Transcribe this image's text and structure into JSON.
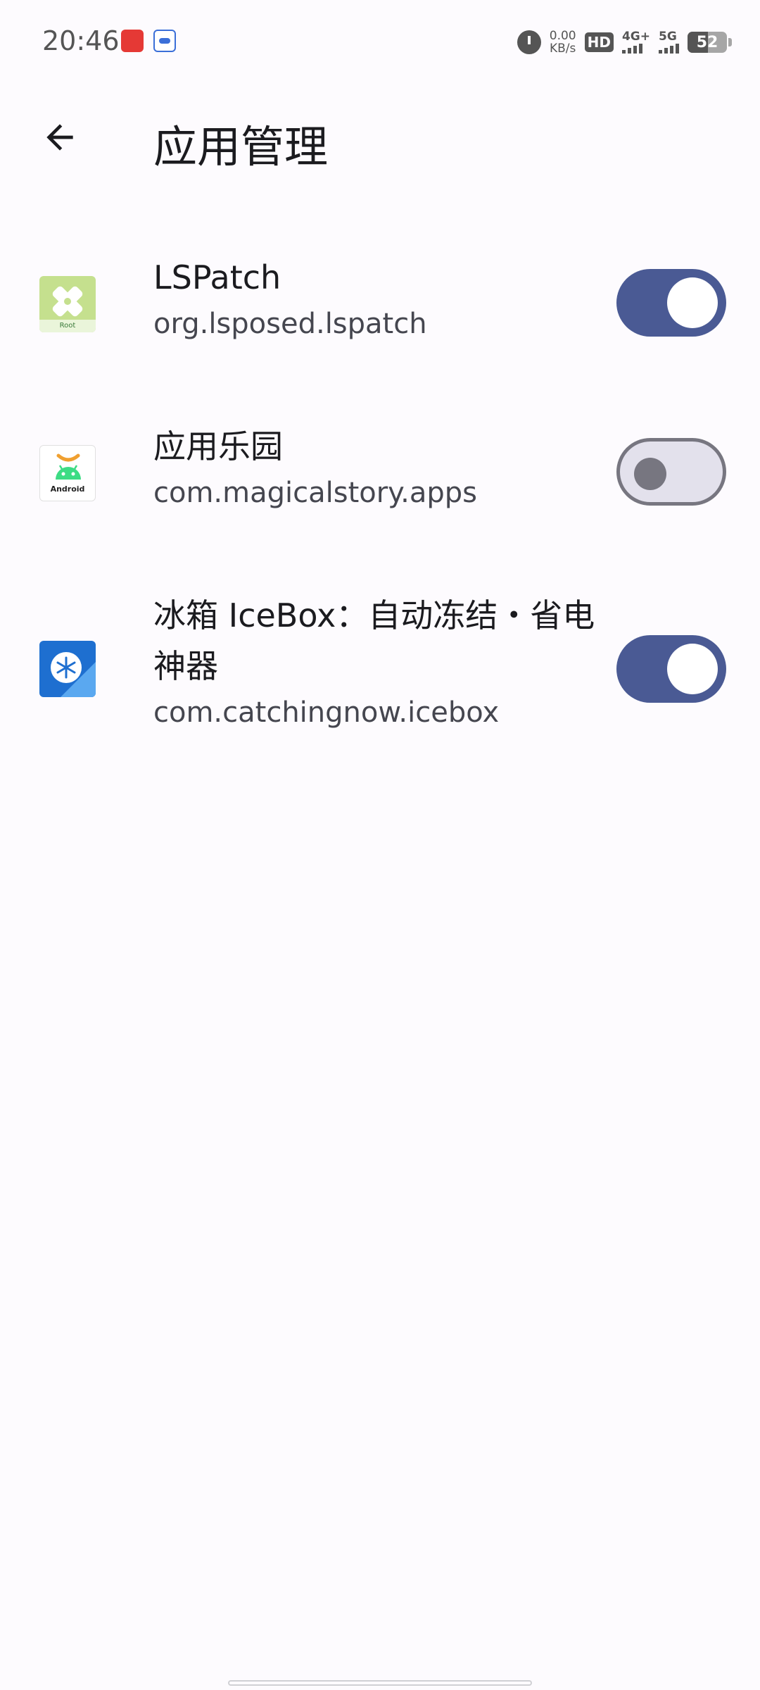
{
  "status_bar": {
    "time": "20:46",
    "net_speed_value": "0.00",
    "net_speed_unit": "KB/s",
    "hd_label": "HD",
    "sim1_label": "4G+",
    "sim2_label": "5G",
    "battery_level": "52",
    "battery_fraction": 0.52
  },
  "app_bar": {
    "title": "应用管理"
  },
  "apps": [
    {
      "name": "LSPatch",
      "package": "org.lsposed.lspatch",
      "enabled": true,
      "icon": "lspatch-icon"
    },
    {
      "name": "应用乐园",
      "package": "com.magicalstory.apps",
      "enabled": false,
      "icon": "android-icon",
      "icon_label": "Android"
    },
    {
      "name": "冰箱 IceBox：自动冻结・省电神器",
      "package": "com.catchingnow.icebox",
      "enabled": true,
      "icon": "icebox-icon"
    }
  ],
  "colors": {
    "accent": "#4a5a94",
    "background": "#fdfbfe",
    "switch_off_track": "#e3e1ec",
    "switch_off_outline": "#777680"
  }
}
